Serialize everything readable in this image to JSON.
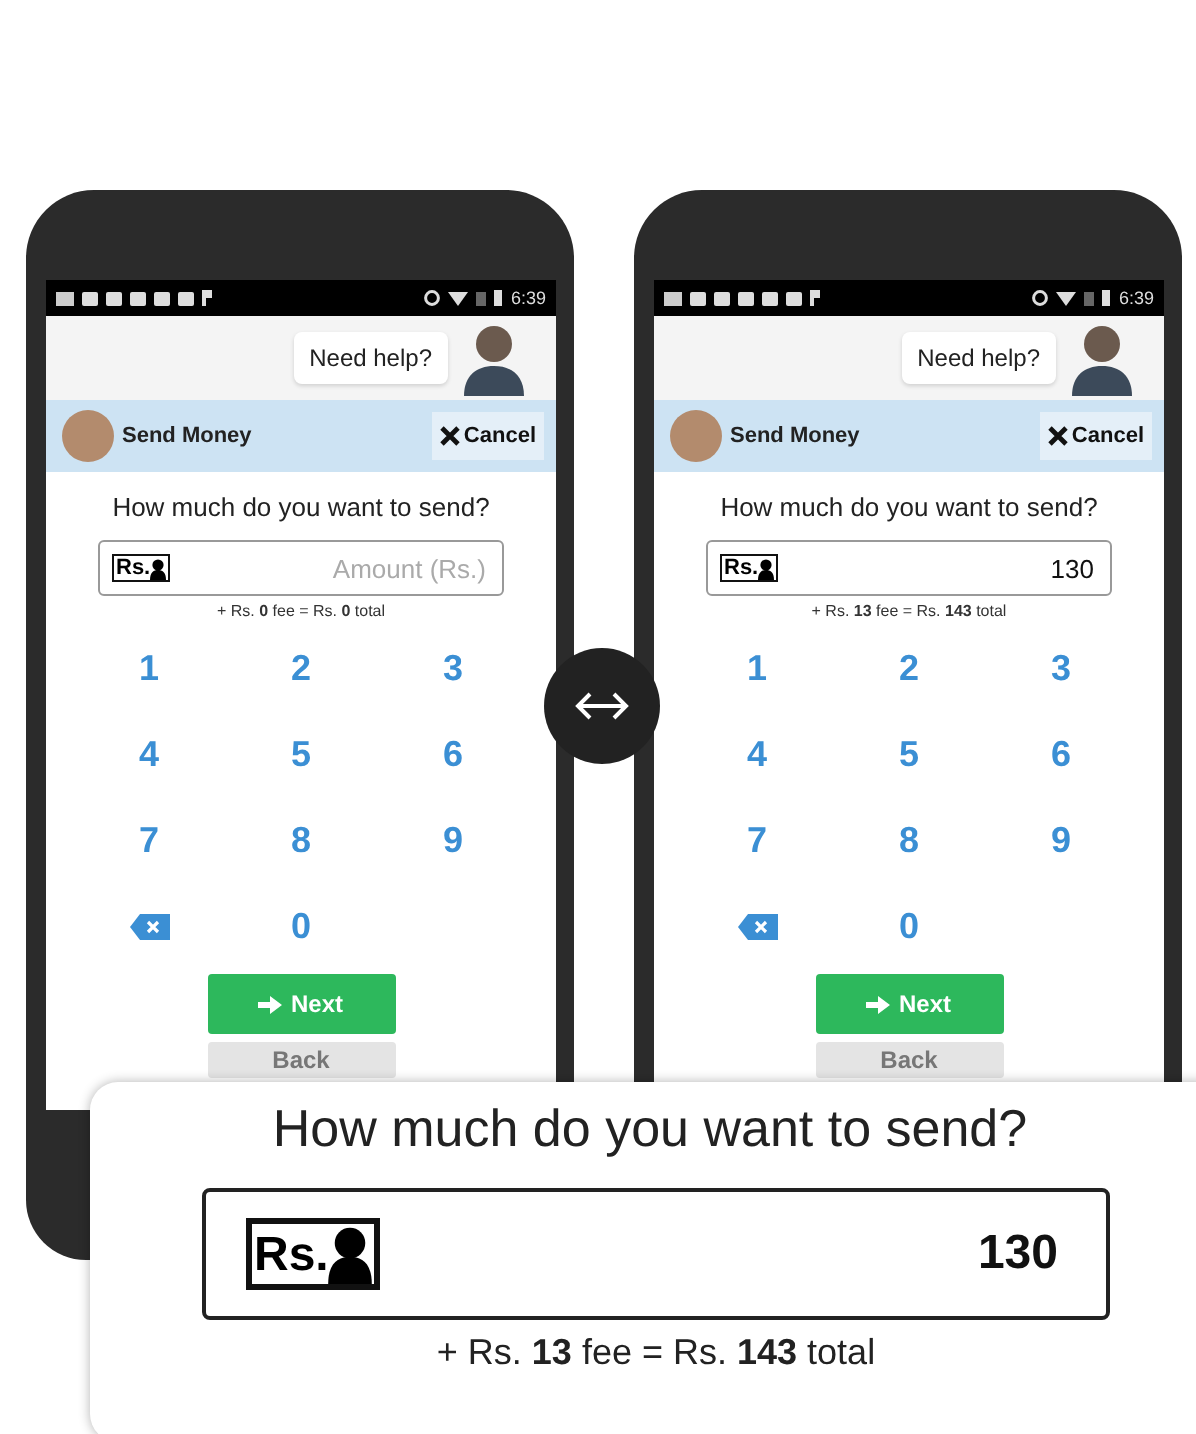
{
  "phones": [
    {
      "status_time": "6:39",
      "help": "Need help?",
      "title": "Send Money",
      "cancel": "Cancel",
      "question": "How much do you want to send?",
      "currency_label": "Rs.",
      "amount_placeholder": "Amount (Rs.)",
      "fee_line": "+ Rs. **0** fee = Rs. **0** total",
      "keys": [
        {
          "kind": "digit",
          "label": "1"
        },
        {
          "kind": "digit",
          "label": "2"
        },
        {
          "kind": "digit",
          "label": "3"
        },
        {
          "kind": "digit",
          "label": "4"
        },
        {
          "kind": "digit",
          "label": "5"
        },
        {
          "kind": "digit",
          "label": "6"
        },
        {
          "kind": "digit",
          "label": "7"
        },
        {
          "kind": "digit",
          "label": "8"
        },
        {
          "kind": "digit",
          "label": "9"
        },
        {
          "kind": "backspace"
        },
        {
          "kind": "digit",
          "label": "0"
        }
      ],
      "next": "Next",
      "back": "Back"
    },
    {
      "status_time": "6:39",
      "help": "Need help?",
      "title": "Send Money",
      "cancel": "Cancel",
      "question": "How much do you want to send?",
      "currency_label": "Rs.",
      "amount_value": "130",
      "fee_line": "+ Rs. **13** fee = Rs. **143** total",
      "keys": [
        {
          "kind": "digit",
          "label": "1"
        },
        {
          "kind": "digit",
          "label": "2"
        },
        {
          "kind": "digit",
          "label": "3"
        },
        {
          "kind": "digit",
          "label": "4"
        },
        {
          "kind": "digit",
          "label": "5"
        },
        {
          "kind": "digit",
          "label": "6"
        },
        {
          "kind": "digit",
          "label": "7"
        },
        {
          "kind": "digit",
          "label": "8"
        },
        {
          "kind": "digit",
          "label": "9"
        },
        {
          "kind": "backspace"
        },
        {
          "kind": "digit",
          "label": "0"
        }
      ],
      "next": "Next",
      "back": "Back"
    }
  ],
  "zoom": {
    "question": "How much do you want to send?",
    "currency_label": "Rs.",
    "amount_value": "130",
    "fee_line": "+ Rs. **13** fee = Rs. **143** total"
  }
}
